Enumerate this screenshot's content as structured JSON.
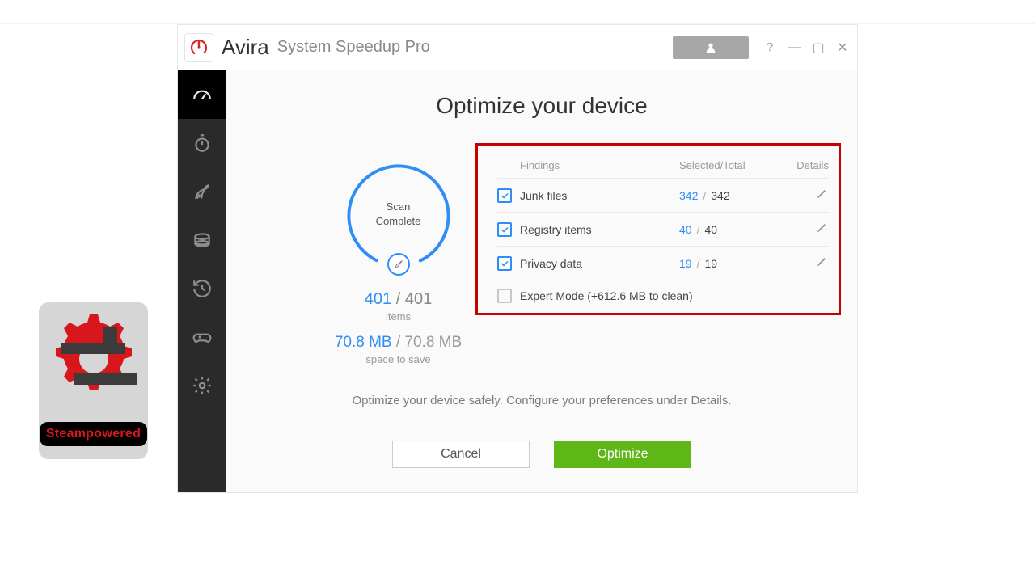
{
  "brand": "Avira",
  "product": "System Speedup Pro",
  "page_title": "Optimize your device",
  "scan": {
    "status_line1": "Scan",
    "status_line2": "Complete",
    "items_selected": "401",
    "items_total": "401",
    "items_label": "items",
    "space_selected": "70.8 MB",
    "space_total": "70.8 MB",
    "space_label": "space to save"
  },
  "findings": {
    "headers": {
      "name": "Findings",
      "count": "Selected/Total",
      "details": "Details"
    },
    "rows": [
      {
        "name": "Junk files",
        "selected": "342",
        "total": "342"
      },
      {
        "name": "Registry items",
        "selected": "40",
        "total": "40"
      },
      {
        "name": "Privacy data",
        "selected": "19",
        "total": "19"
      }
    ],
    "expert_label": "Expert Mode (+612.6 MB to clean)"
  },
  "hint": "Optimize your device safely. Configure your preferences under Details.",
  "actions": {
    "cancel": "Cancel",
    "optimize": "Optimize"
  },
  "watermark": "Steampowered"
}
